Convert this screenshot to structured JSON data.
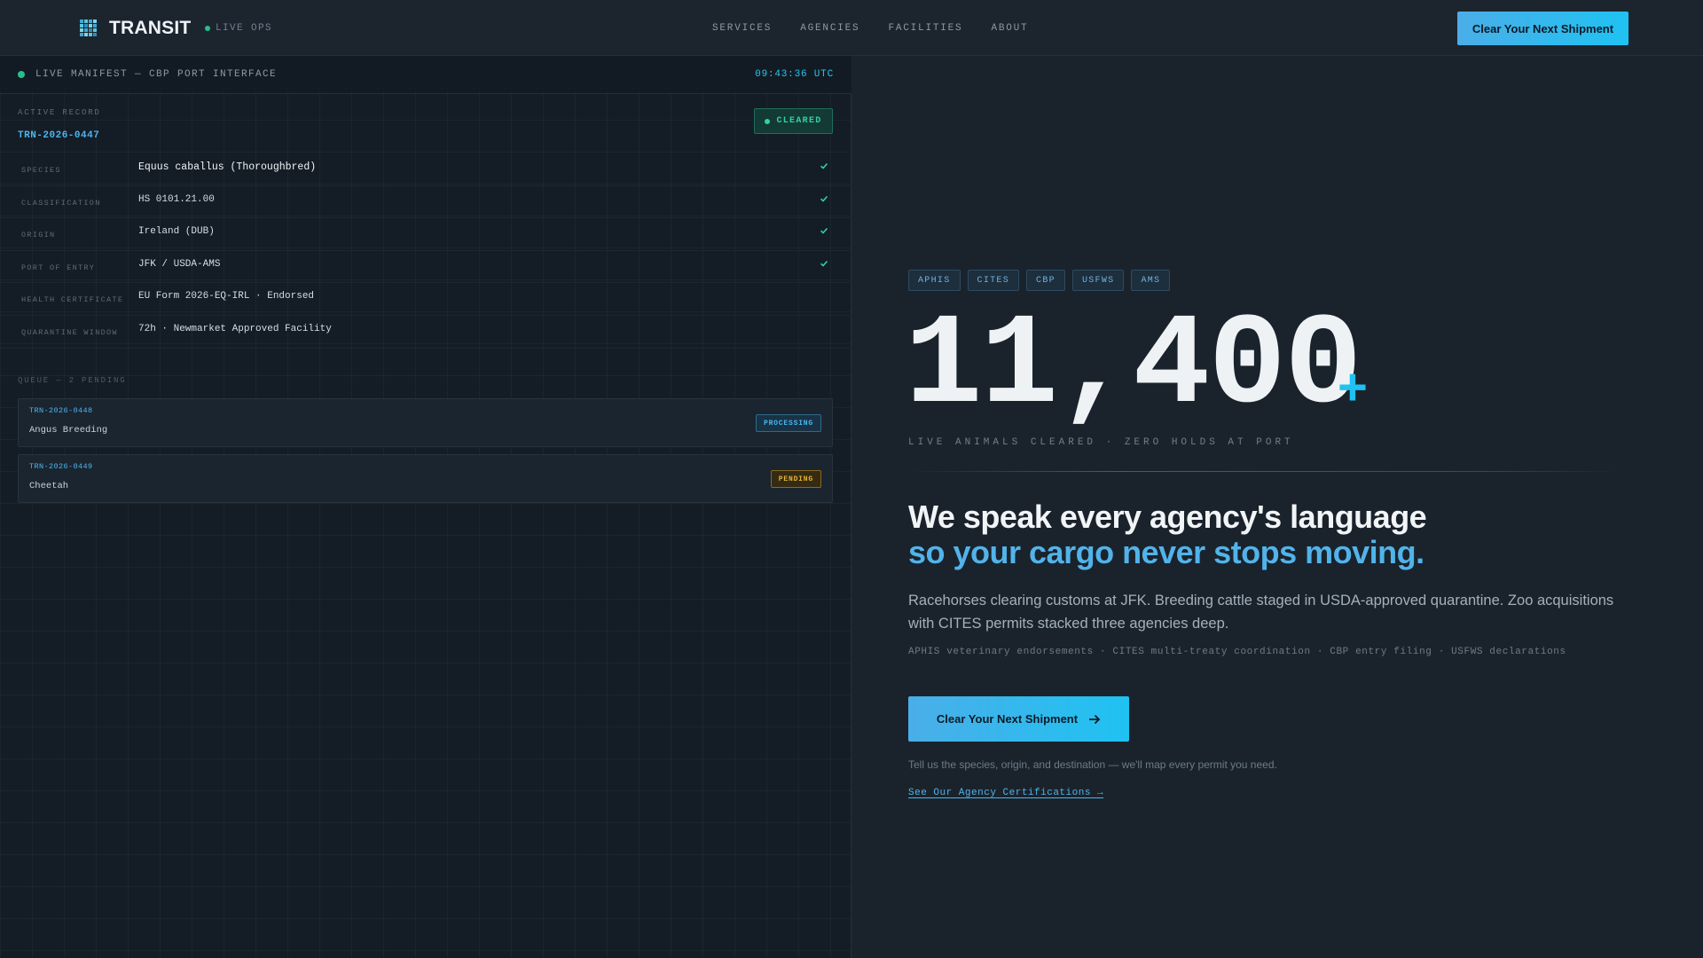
{
  "brand": {
    "name": "TRANSIT",
    "status": "LIVE OPS",
    "logo_icon": "grid-logo-icon"
  },
  "nav": {
    "links": [
      "SERVICES",
      "AGENCIES",
      "FACILITIES",
      "ABOUT"
    ],
    "cta_label": "Clear Your Next Shipment"
  },
  "manifest": {
    "title": "LIVE MANIFEST — CBP PORT INTERFACE",
    "time": "09:43:36 UTC",
    "active_label": "ACTIVE RECORD",
    "active_id": "TRN-2026-0447",
    "status": "CLEARED",
    "fields": [
      {
        "label": "SPECIES",
        "value": "Equus caballus (Thoroughbred)",
        "verified": true
      },
      {
        "label": "CLASSIFICATION",
        "value": "HS 0101.21.00",
        "verified": true
      },
      {
        "label": "ORIGIN",
        "value": "Ireland (DUB)",
        "verified": true
      },
      {
        "label": "PORT OF ENTRY",
        "value": "JFK / USDA-AMS",
        "verified": true
      },
      {
        "label": "HEALTH CERTIFICATE",
        "value": "EU Form 2026-EQ-IRL · Endorsed",
        "verified": false
      },
      {
        "label": "QUARANTINE WINDOW",
        "value": "72h · Newmarket Approved Facility",
        "verified": false
      }
    ],
    "queue_label": "QUEUE — 2 PENDING",
    "queue": [
      {
        "id": "TRN-2026-0448",
        "name": "Angus Breeding",
        "status": "PROCESSING"
      },
      {
        "id": "TRN-2026-0449",
        "name": "Cheetah",
        "status": "PENDING"
      }
    ]
  },
  "hero": {
    "tags": [
      "APHIS",
      "CITES",
      "CBP",
      "USFWS",
      "AMS"
    ],
    "stat": "11,400",
    "stat_suffix": "+",
    "stat_caption": "LIVE ANIMALS CLEARED · ZERO HOLDS AT PORT",
    "headline_1": "We speak every agency's language",
    "headline_2": "so your cargo never stops moving.",
    "body": "Racehorses clearing customs at JFK. Breeding cattle staged in USDA-approved quarantine. Zoo acquisitions with CITES permits stacked three agencies deep.",
    "sub": "APHIS veterinary endorsements · CITES multi-treaty coordination · CBP entry filing · USFWS declarations",
    "cta_label": "Clear Your Next Shipment",
    "cta_note": "Tell us the species, origin, and destination — we'll map every permit you need.",
    "cert_link": "See Our Agency Certifications →"
  },
  "colors": {
    "accent": "#1fc2f2",
    "accent_blue": "#52b3ea",
    "success": "#2fd3a0",
    "warning": "#e2b33a",
    "background": "#1a232c"
  }
}
